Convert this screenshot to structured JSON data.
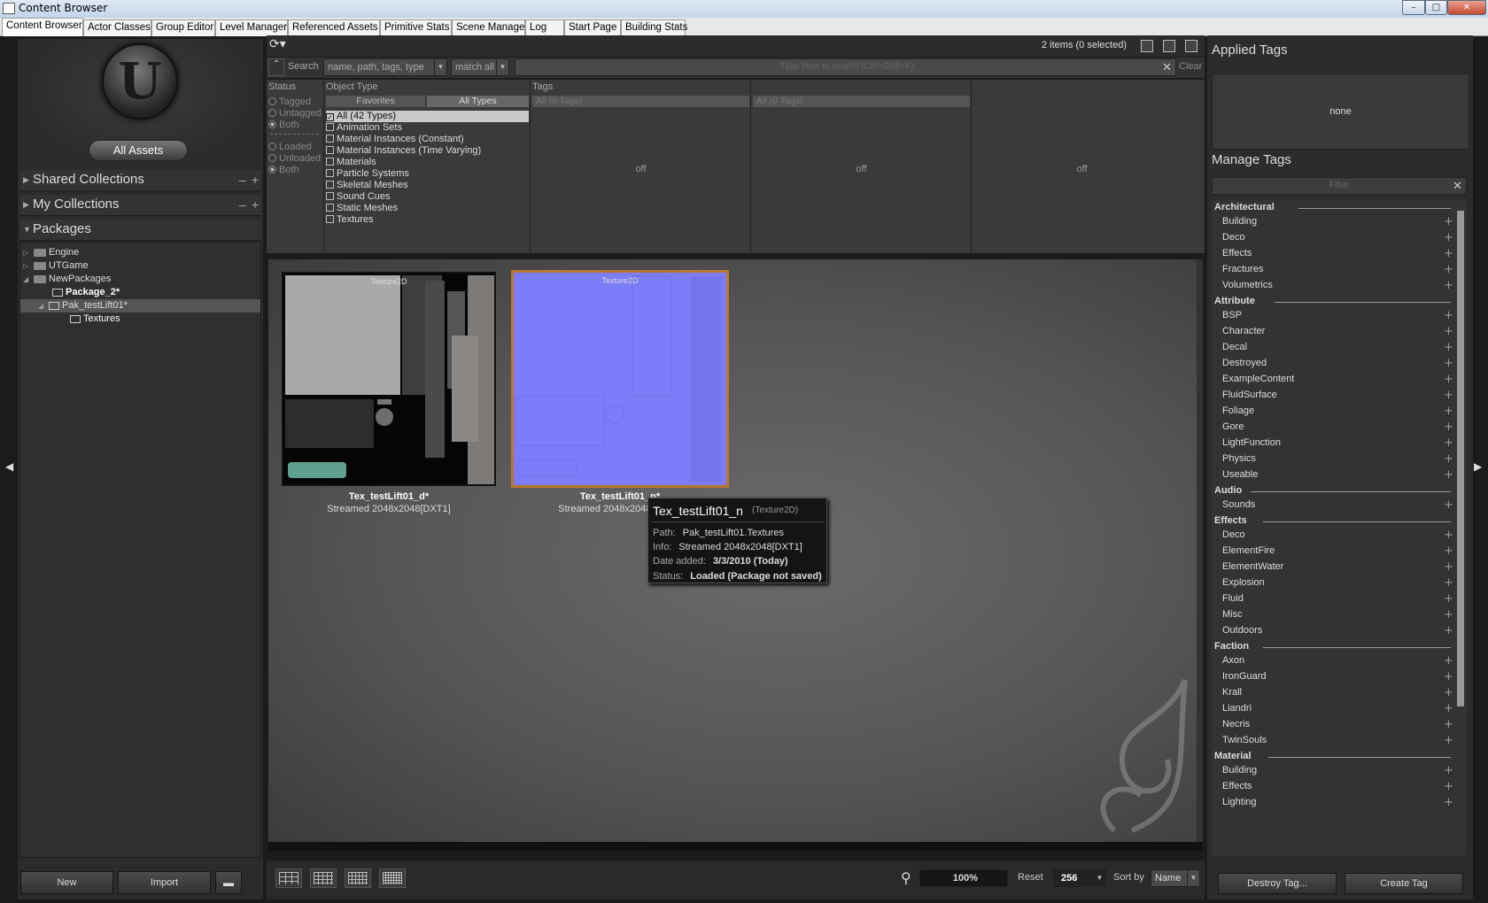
{
  "window": {
    "title": "Content Browser"
  },
  "tabs": [
    "Content Browser",
    "Actor Classes",
    "Group Editor",
    "Level Manager",
    "Referenced Assets",
    "Primitive Stats",
    "Scene Manager",
    "Log",
    "Start Page",
    "Building Stats"
  ],
  "left": {
    "all_assets": "All Assets",
    "shared_collections": "Shared Collections",
    "my_collections": "My Collections",
    "packages": "Packages",
    "tree": [
      "Engine",
      "UTGame",
      "NewPackages",
      "Package_2*",
      "Pak_testLift01*",
      "Textures"
    ],
    "new_button": "New",
    "import_button": "Import"
  },
  "toolbar": {
    "items_count": "2 items (0 selected)"
  },
  "search": {
    "label": "Search",
    "field_scope": "name, path, tags, type",
    "match": "match all",
    "placeholder": "Type here to search  (Ctrl+Shift+F)",
    "clear": "Clear"
  },
  "filters": {
    "status_header": "Status",
    "status_a": [
      "Tagged",
      "Untagged",
      "Both"
    ],
    "status_b": [
      "Loaded",
      "Unloaded",
      "Both"
    ],
    "object_type_header": "Object Type",
    "favorites": "Favorites",
    "all_types": "All Types",
    "types": [
      "All (42 Types)",
      "Animation Sets",
      "Material Instances (Constant)",
      "Material Instances (Time Varying)",
      "Materials",
      "Particle Systems",
      "Skeletal Meshes",
      "Sound Cues",
      "Static Meshes",
      "Textures"
    ],
    "tags_header": "Tags",
    "all_tags": "All (0 Tags)",
    "off": "off"
  },
  "assets": [
    {
      "tag": "Texture2D",
      "name": "Tex_testLift01_d*",
      "info": "Streamed 2048x2048[DXT1]"
    },
    {
      "tag": "Texture2D",
      "name": "Tex_testLift01_n*",
      "info": "Streamed 2048x2048[DXT1]"
    }
  ],
  "tooltip": {
    "title": "Tex_testLift01_n",
    "type": "(Texture2D)",
    "path_label": "Path:",
    "path": "Pak_testLift01.Textures",
    "info_label": "Info:",
    "info": "Streamed 2048x2048[DXT1]",
    "date_label": "Date added:",
    "date": "3/3/2010 (Today)",
    "status_label": "Status:",
    "status": "Loaded (Package not saved)"
  },
  "bottom": {
    "zoom": "100%",
    "reset": "Reset",
    "size": "256",
    "sort_label": "Sort by",
    "sort_value": "Name"
  },
  "right": {
    "applied_tags": "Applied Tags",
    "applied_value": "none",
    "manage_tags": "Manage Tags",
    "filter_placeholder": "Filter",
    "categories": [
      {
        "name": "Architectural",
        "tags": [
          "Building",
          "Deco",
          "Effects",
          "Fractures",
          "Volumetrics"
        ]
      },
      {
        "name": "Attribute",
        "tags": [
          "BSP",
          "Character",
          "Decal",
          "Destroyed",
          "ExampleContent",
          "FluidSurface",
          "Foliage",
          "Gore",
          "LightFunction",
          "Physics",
          "Useable"
        ]
      },
      {
        "name": "Audio",
        "tags": [
          "Sounds"
        ]
      },
      {
        "name": "Effects",
        "tags": [
          "Deco",
          "ElementFire",
          "ElementWater",
          "Explosion",
          "Fluid",
          "Misc",
          "Outdoors"
        ]
      },
      {
        "name": "Faction",
        "tags": [
          "Axon",
          "IronGuard",
          "Krall",
          "Liandri",
          "Necris",
          "TwinSouls"
        ]
      },
      {
        "name": "Material",
        "tags": [
          "Building",
          "Effects",
          "Lighting"
        ]
      }
    ],
    "destroy_tag": "Destroy Tag...",
    "create_tag": "Create Tag"
  }
}
